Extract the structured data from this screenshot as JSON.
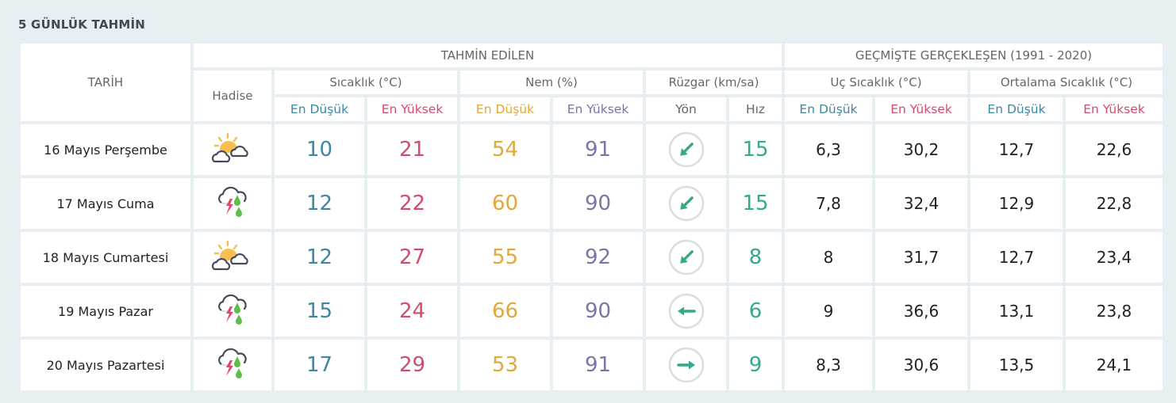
{
  "title": "5 GÜNLÜK TAHMİN",
  "headers": {
    "date": "TARİH",
    "forecast_group": "TAHMİN EDİLEN",
    "history_group": "GEÇMİŞTE GERÇEKLEŞEN (1991 - 2020)",
    "event": "Hadise",
    "temperature": "Sıcaklık (°C)",
    "humidity": "Nem (%)",
    "wind": "Rüzgar (km/sa)",
    "extreme_temp": "Uç Sıcaklık (°C)",
    "avg_temp": "Ortalama Sıcaklık (°C)",
    "low": "En Düşük",
    "high": "En Yüksek",
    "direction": "Yön",
    "speed": "Hız"
  },
  "colors": {
    "low": "#3d87a1",
    "high": "#d24c6e",
    "humidity_low": "#e0a83a",
    "humidity_high": "#7b75a6",
    "wind": "#35a98b"
  },
  "rows": [
    {
      "date": "16 Mayıs Perşembe",
      "icon": "partly-cloudy-icon",
      "temp_low": "10",
      "temp_high": "21",
      "hum_low": "54",
      "hum_high": "91",
      "wind_dir": "southwest",
      "wind_dir_deg": 225,
      "wind_speed": "15",
      "ext_low": "6,3",
      "ext_high": "30,2",
      "avg_low": "12,7",
      "avg_high": "22,6"
    },
    {
      "date": "17 Mayıs Cuma",
      "icon": "thunderstorm-rain-icon",
      "temp_low": "12",
      "temp_high": "22",
      "hum_low": "60",
      "hum_high": "90",
      "wind_dir": "southwest",
      "wind_dir_deg": 225,
      "wind_speed": "15",
      "ext_low": "7,8",
      "ext_high": "32,4",
      "avg_low": "12,9",
      "avg_high": "22,8"
    },
    {
      "date": "18 Mayıs Cumartesi",
      "icon": "partly-cloudy-icon",
      "temp_low": "12",
      "temp_high": "27",
      "hum_low": "55",
      "hum_high": "92",
      "wind_dir": "southwest",
      "wind_dir_deg": 225,
      "wind_speed": "8",
      "ext_low": "8",
      "ext_high": "31,7",
      "avg_low": "12,7",
      "avg_high": "23,4"
    },
    {
      "date": "19 Mayıs Pazar",
      "icon": "thunderstorm-rain-icon",
      "temp_low": "15",
      "temp_high": "24",
      "hum_low": "66",
      "hum_high": "90",
      "wind_dir": "west",
      "wind_dir_deg": 270,
      "wind_speed": "6",
      "ext_low": "9",
      "ext_high": "36,6",
      "avg_low": "13,1",
      "avg_high": "23,8"
    },
    {
      "date": "20 Mayıs Pazartesi",
      "icon": "thunderstorm-rain-icon",
      "temp_low": "17",
      "temp_high": "29",
      "hum_low": "53",
      "hum_high": "91",
      "wind_dir": "east",
      "wind_dir_deg": 90,
      "wind_speed": "9",
      "ext_low": "8,3",
      "ext_high": "30,6",
      "avg_low": "13,5",
      "avg_high": "24,1"
    }
  ]
}
